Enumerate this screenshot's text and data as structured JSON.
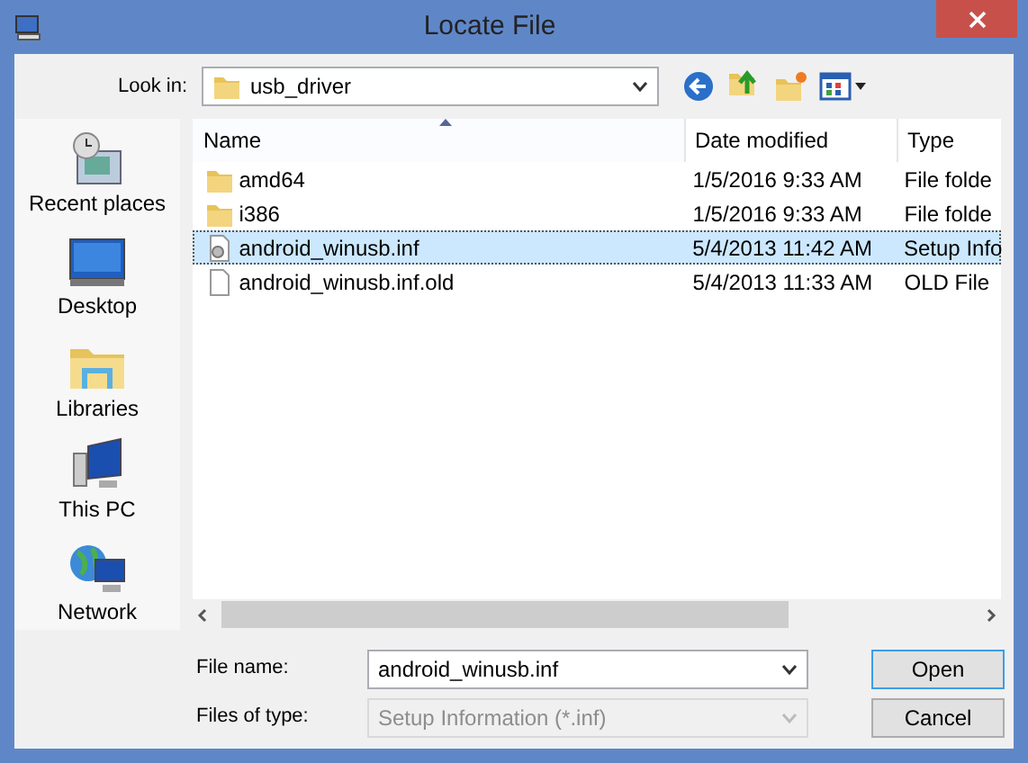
{
  "window": {
    "title": "Locate File"
  },
  "look_in": {
    "label": "Look in:",
    "value": "usb_driver"
  },
  "places": [
    {
      "label": "Recent places",
      "kind": "recent"
    },
    {
      "label": "Desktop",
      "kind": "desktop"
    },
    {
      "label": "Libraries",
      "kind": "libraries"
    },
    {
      "label": "This PC",
      "kind": "pc"
    },
    {
      "label": "Network",
      "kind": "network"
    }
  ],
  "columns": [
    {
      "label": "Name",
      "sorted": true
    },
    {
      "label": "Date modified",
      "sorted": false
    },
    {
      "label": "Type",
      "sorted": false
    }
  ],
  "files": [
    {
      "name": "amd64",
      "kind": "folder",
      "date": "1/5/2016 9:33 AM",
      "type": "File folde",
      "selected": false
    },
    {
      "name": "i386",
      "kind": "folder",
      "date": "1/5/2016 9:33 AM",
      "type": "File folde",
      "selected": false
    },
    {
      "name": "android_winusb.inf",
      "kind": "setup",
      "date": "5/4/2013 11:42 AM",
      "type": "Setup Info",
      "selected": true
    },
    {
      "name": "android_winusb.inf.old",
      "kind": "file",
      "date": "5/4/2013 11:33 AM",
      "type": "OLD File",
      "selected": false
    }
  ],
  "file_name": {
    "label": "File name:",
    "value": "android_winusb.inf"
  },
  "file_type": {
    "label": "Files of type:",
    "value": "Setup Information (*.inf)",
    "disabled": true
  },
  "buttons": [
    {
      "label": "Open",
      "default": true
    },
    {
      "label": "Cancel",
      "default": false
    }
  ]
}
